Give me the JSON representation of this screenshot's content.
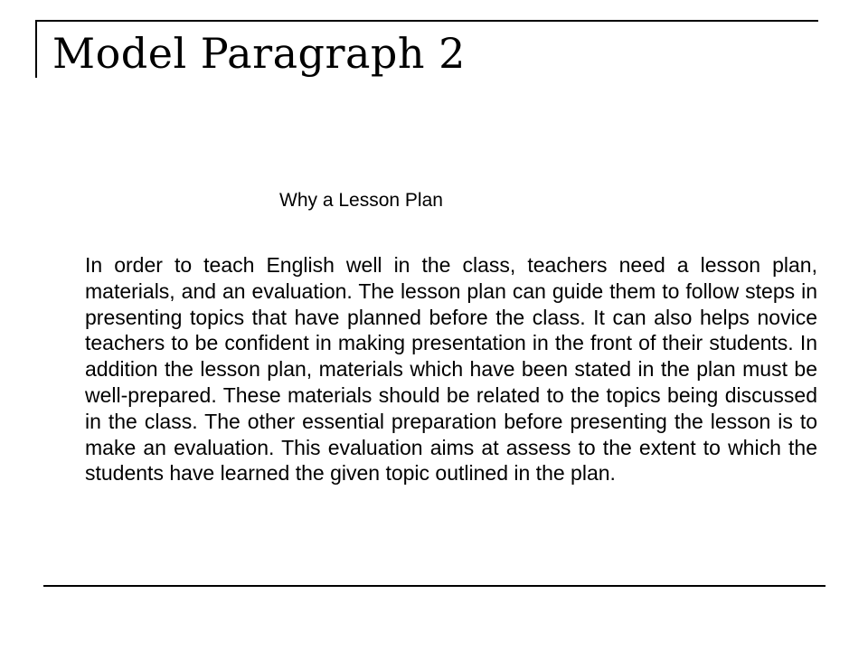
{
  "slide": {
    "title": "Model Paragraph 2",
    "paragraph_heading": "Why a Lesson Plan",
    "paragraph_body": "In order to teach English well in the class, teachers need a lesson plan, materials, and an evaluation. The lesson plan can guide them to follow steps in presenting topics that have planned before the class. It can also helps novice teachers to be confident in making presentation in the front of their students. In addition the lesson plan, materials which have been stated in the plan  must be well-prepared. These materials should be related to the topics being discussed in the class. The other essential preparation before presenting the lesson is to make an  evaluation. This evaluation aims at assess to the extent to which the students have learned the given topic outlined in the plan."
  }
}
